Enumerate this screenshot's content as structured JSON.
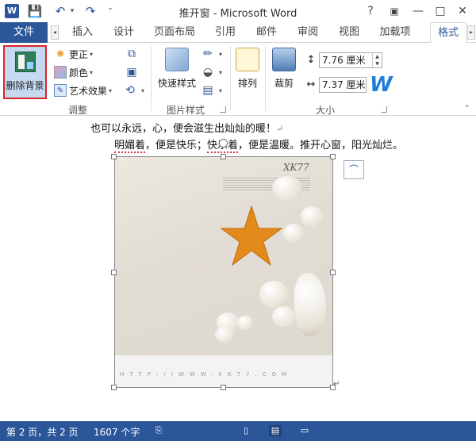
{
  "window": {
    "title": "推开窗 - Microsoft Word",
    "app_logo": "W",
    "controls": {
      "help": "?",
      "restore": "▣",
      "minimize": "—",
      "maximize": "□",
      "close": "✕"
    }
  },
  "qat": {
    "save_icon": "💾",
    "undo_icon": "↶",
    "redo_icon": "↷",
    "customize": "⁼"
  },
  "tabs": {
    "file": "文件",
    "items": [
      "插入",
      "设计",
      "页面布局",
      "引用",
      "邮件",
      "审阅",
      "视图",
      "加载项"
    ],
    "active": "格式"
  },
  "ribbon": {
    "adjust": {
      "remove_background": "删除背景",
      "corrections": "更正",
      "color": "颜色",
      "artistic_effects": "艺术效果",
      "label": "调整"
    },
    "picture_styles": {
      "quick_styles": "快速样式",
      "label": "图片样式"
    },
    "arrange": {
      "label": "排列"
    },
    "size": {
      "crop": "裁剪",
      "height": "7.76 厘米",
      "width": "7.37 厘米",
      "label": "大小"
    }
  },
  "document": {
    "line1": "也可以永远，心，便会滋生出灿灿的暖！",
    "line2_a": "明媚着",
    "line2_b": "，便是快乐；",
    "line2_c": "快乐着",
    "line2_d": "，便是温暖。推开心窗，阳光灿烂。",
    "para_mark": "↵",
    "picture": {
      "brand": "XK77",
      "url": "HTTP://WWW.XK77.COM"
    }
  },
  "statusbar": {
    "page": "第 2 页，共 2 页",
    "words": "1607 个字"
  },
  "colors": {
    "accent": "#2b579a",
    "highlight_border": "#d9252b"
  }
}
